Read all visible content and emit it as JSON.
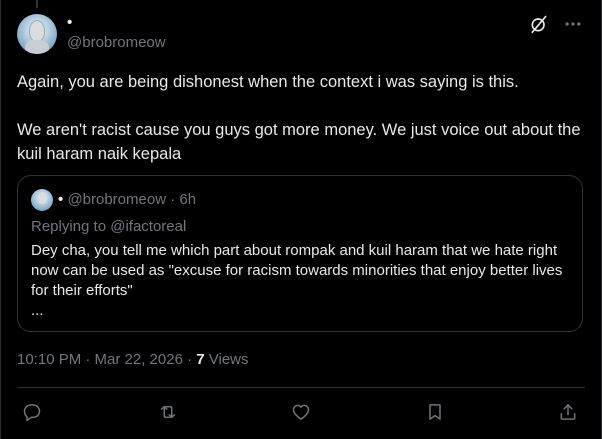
{
  "tweet": {
    "author": {
      "display_name": "•",
      "handle": "@brobromeow"
    },
    "paragraphs": [
      "Again, you are being dishonest when the context i was saying is this.",
      "We aren't racist cause you guys got more money. We just voice out about the kuil haram naik kepala"
    ],
    "timestamp": "10:10 PM · Mar 22, 2026 · ",
    "views_count": "7",
    "views_label": " Views"
  },
  "quote": {
    "display_name": "•",
    "handle": "@brobromeow",
    "separator": " · ",
    "age": "6h",
    "replying_to": "Replying to @ifactoreal",
    "text": "Dey cha, you tell me which part about rompak and kuil haram that we hate right now can be used as \"excuse for racism towards minorities that enjoy better lives for their efforts\"",
    "ellipsis": "..."
  },
  "icons": {
    "grok": "grok-icon",
    "more": "more-icon",
    "reply": "reply-icon",
    "retweet": "retweet-icon",
    "like": "like-icon",
    "bookmark": "bookmark-icon",
    "share": "share-icon"
  },
  "colors": {
    "background": "#000000",
    "text_primary": "#e7e9ea",
    "text_secondary": "#71767b",
    "border": "#2f3336"
  }
}
